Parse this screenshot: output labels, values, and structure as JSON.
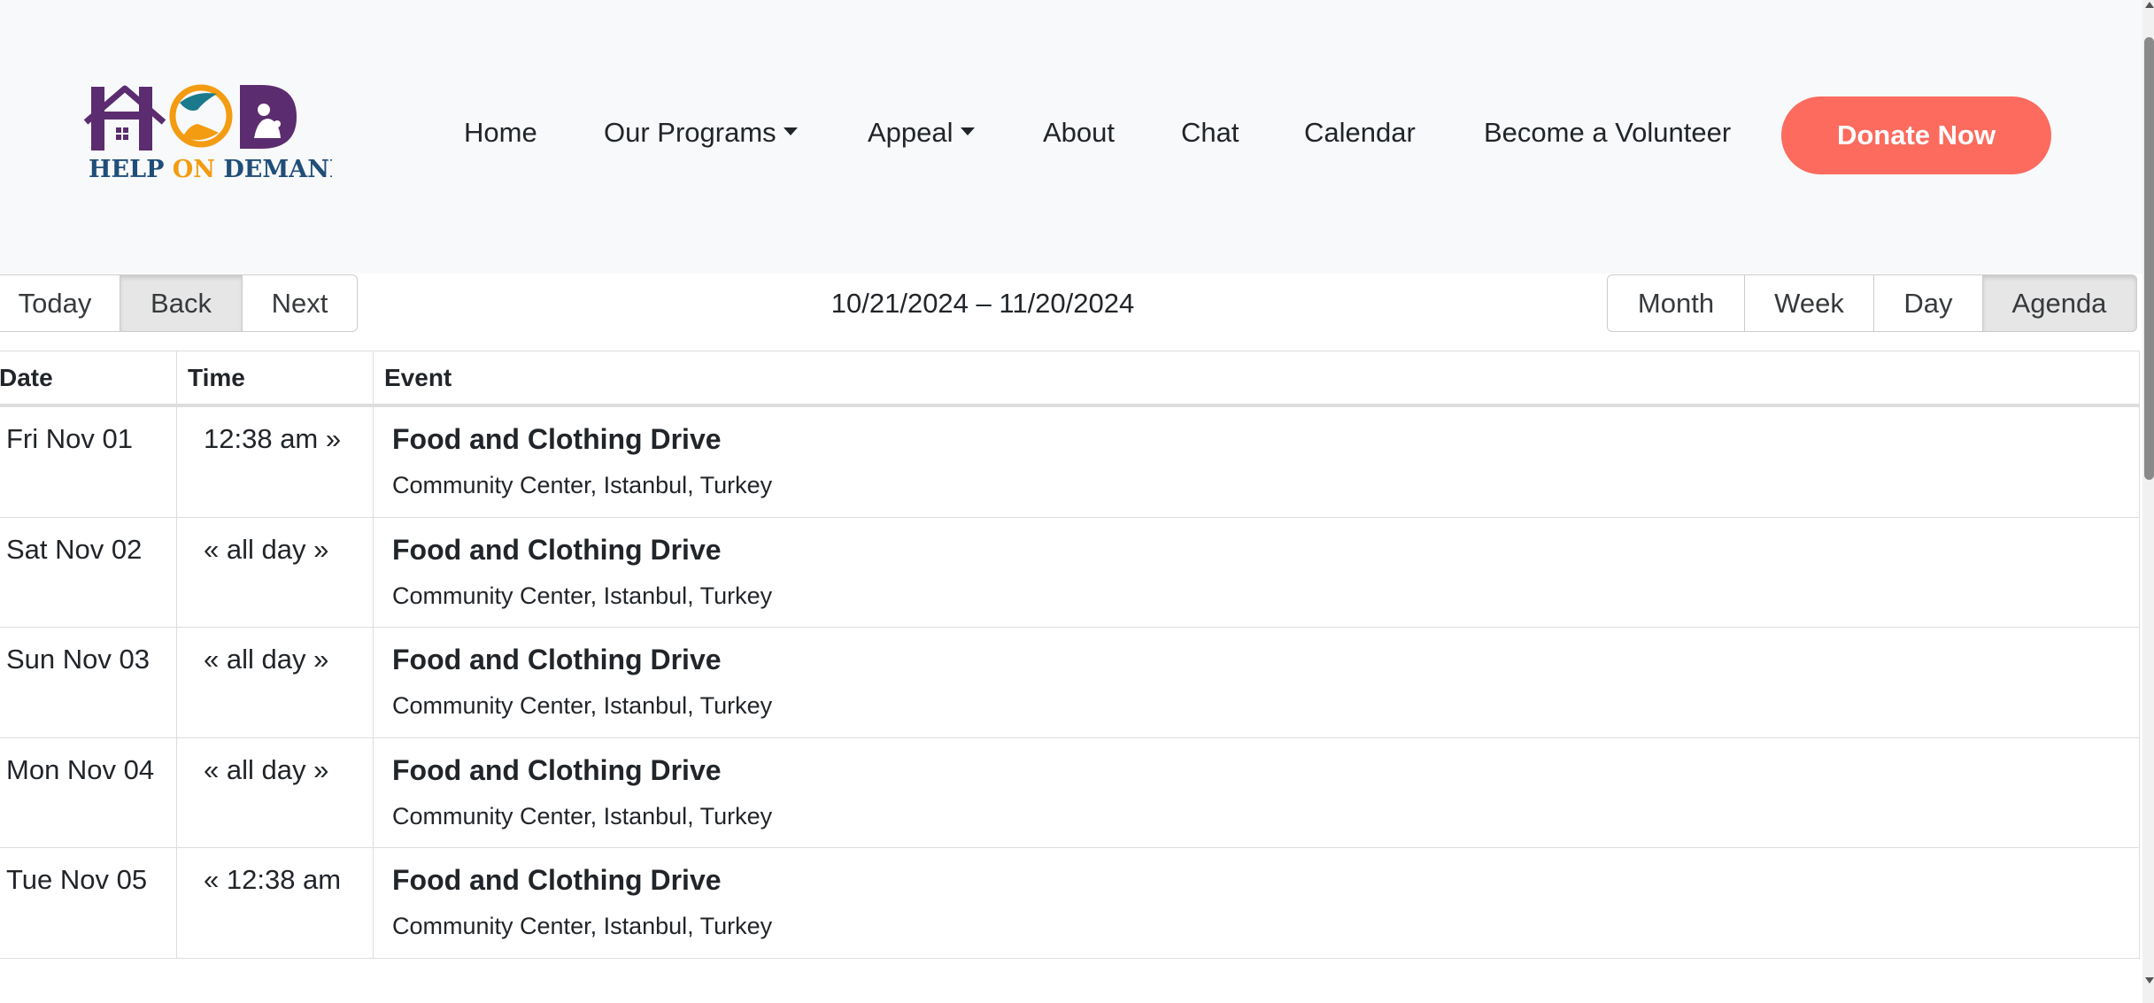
{
  "brand": {
    "logo_initials": [
      "H",
      "O",
      "D"
    ],
    "logo_text_parts": [
      "HELP ",
      "ON",
      " DEMAND"
    ],
    "colors": {
      "purple": "#5b2c6f",
      "navy": "#1f4e79",
      "orange": "#f39c12",
      "teal": "#1a7a8c",
      "donate": "#fc6b5e"
    }
  },
  "nav": {
    "items": [
      {
        "label": "Home",
        "has_dropdown": false
      },
      {
        "label": "Our Programs",
        "has_dropdown": true
      },
      {
        "label": "Appeal",
        "has_dropdown": true
      },
      {
        "label": "About",
        "has_dropdown": false
      },
      {
        "label": "Chat",
        "has_dropdown": false
      },
      {
        "label": "Calendar",
        "has_dropdown": false
      },
      {
        "label": "Become a Volunteer",
        "has_dropdown": false
      }
    ],
    "donate_label": "Donate Now"
  },
  "toolbar": {
    "nav_buttons": [
      "Today",
      "Back",
      "Next"
    ],
    "active_nav": "Back",
    "range": "10/21/2024 – 11/20/2024",
    "view_buttons": [
      "Month",
      "Week",
      "Day",
      "Agenda"
    ],
    "active_view": "Agenda"
  },
  "agenda": {
    "headers": {
      "date": "Date",
      "time": "Time",
      "event": "Event"
    },
    "rows": [
      {
        "date": "Fri Nov 01",
        "time": "12:38 am »",
        "title": "Food and Clothing Drive",
        "location": "Community Center, Istanbul, Turkey"
      },
      {
        "date": "Sat Nov 02",
        "time": "« all day »",
        "title": "Food and Clothing Drive",
        "location": "Community Center, Istanbul, Turkey"
      },
      {
        "date": "Sun Nov 03",
        "time": "« all day »",
        "title": "Food and Clothing Drive",
        "location": "Community Center, Istanbul, Turkey"
      },
      {
        "date": "Mon Nov 04",
        "time": "« all day »",
        "title": "Food and Clothing Drive",
        "location": "Community Center, Istanbul, Turkey"
      },
      {
        "date": "Tue Nov 05",
        "time": "« 12:38 am",
        "title": "Food and Clothing Drive",
        "location": "Community Center, Istanbul, Turkey"
      }
    ]
  }
}
